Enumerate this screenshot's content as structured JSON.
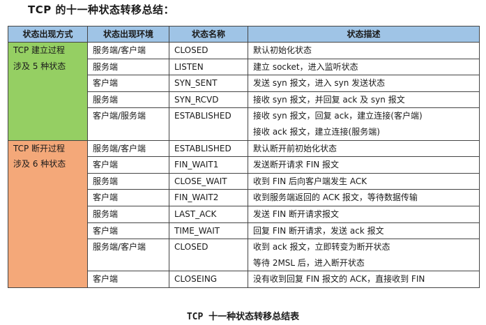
{
  "title": "TCP 的十一种状态转移总结：",
  "headers": [
    "状态出现方式",
    "状态出现环境",
    "状态名称",
    "状态描述"
  ],
  "groups": [
    {
      "label_line1": "TCP 建立过程",
      "label_line2": "涉及 5 种状态",
      "color": "#95cf63",
      "rows": [
        {
          "env": "服务端/客户端",
          "state": "CLOSED",
          "desc": [
            "默认初始化状态"
          ]
        },
        {
          "env": "服务端",
          "state": "LISTEN",
          "desc": [
            "建立 socket，进入监听状态"
          ]
        },
        {
          "env": "客户端",
          "state": "SYN_SENT",
          "desc": [
            "发送 syn 报文，进入 syn 发送状态"
          ]
        },
        {
          "env": "服务端",
          "state": "SYN_RCVD",
          "desc": [
            "接收 syn 报文，并回复 ack 及 syn 报文"
          ]
        },
        {
          "env": "客户端/服务端",
          "state": "ESTABLISHED",
          "desc": [
            "接收 syn 报文，回复 ack，建立连接(客户端)",
            "接收 ack 报文，建立连接(服务端)"
          ]
        }
      ]
    },
    {
      "label_line1": "TCP 断开过程",
      "label_line2": "涉及 6 种状态",
      "color": "#f4a879",
      "rows": [
        {
          "env": "服务端/客户端",
          "state": "ESTABLISHED",
          "desc": [
            "默认断开前初始化状态"
          ]
        },
        {
          "env": "客户端",
          "state": "FIN_WAIT1",
          "desc": [
            "发送断开请求 FIN 报文"
          ]
        },
        {
          "env": "服务端",
          "state": "CLOSE_WAIT",
          "desc": [
            "收到 FIN 后向客户端发生 ACK"
          ]
        },
        {
          "env": "客户端",
          "state": "FIN_WAIT2",
          "desc": [
            "收到服务端返回的 ACK 报文，等待数据传输"
          ]
        },
        {
          "env": "服务端",
          "state": "LAST_ACK",
          "desc": [
            "发送 FIN 断开请求报文"
          ]
        },
        {
          "env": "客户端",
          "state": "TIME_WAIT",
          "desc": [
            "回复 FIN 断开请求，发送 ack 报文"
          ]
        },
        {
          "env": "服务端/客户端",
          "state": "CLOSED",
          "desc": [
            "收到 ack 报文，立即转变为断开状态",
            "等待 2MSL 后，进入断开状态"
          ]
        },
        {
          "env": "客户端",
          "state": "CLOSEING",
          "desc": [
            "没有收到回复 FIN 报文的 ACK，直接收到 FIN"
          ]
        }
      ]
    }
  ],
  "caption": "TCP 十一种状态转移总结表"
}
